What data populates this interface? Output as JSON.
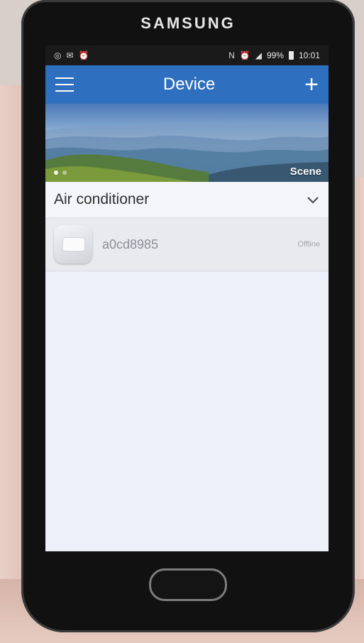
{
  "device_brand": "SAMSUNG",
  "status_bar": {
    "battery": "99%",
    "time": "10:01"
  },
  "app_bar": {
    "title": "Device",
    "menu_icon": "hamburger-menu-icon",
    "add_icon": "plus-icon"
  },
  "banner": {
    "label": "Scene",
    "active_dot": 0,
    "dots": 2
  },
  "section": {
    "title": "Air conditioner",
    "toggle_icon": "chevron-down-icon"
  },
  "devices": [
    {
      "name": "a0cd8985",
      "status": "Offline",
      "icon": "air-conditioner-icon"
    }
  ],
  "colors": {
    "app_bar": "#2f6fbf",
    "screen_bg": "#eef0f9"
  }
}
